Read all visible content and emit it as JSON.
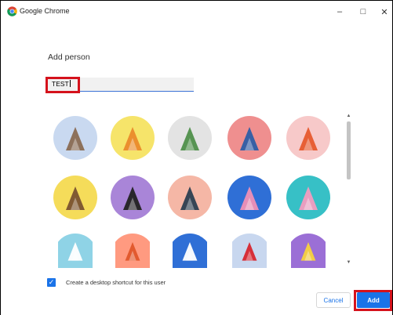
{
  "window": {
    "title": "Google Chrome",
    "controls": {
      "minimize": "–",
      "maximize": "□",
      "close": "✕"
    }
  },
  "dialog": {
    "heading": "Add person",
    "name_input": {
      "value": "TEST",
      "placeholder": ""
    },
    "avatars": [
      {
        "name": "origami cat",
        "bg": "#c9d9f0",
        "accent": "#8a6b52"
      },
      {
        "name": "origami fox",
        "bg": "#f6e46a",
        "accent": "#ea8a2b"
      },
      {
        "name": "origami dragon",
        "bg": "#e3e3e3",
        "accent": "#4f8f4a"
      },
      {
        "name": "origami elephant",
        "bg": "#ef8f8f",
        "accent": "#2d5ea6"
      },
      {
        "name": "origami fox red",
        "bg": "#f7c9c9",
        "accent": "#e65a2e"
      },
      {
        "name": "origami monkey",
        "bg": "#f5dc5a",
        "accent": "#7a5230"
      },
      {
        "name": "origami panda",
        "bg": "#a985d8",
        "accent": "#222222"
      },
      {
        "name": "origami penguin",
        "bg": "#f5b7a6",
        "accent": "#2c3e50"
      },
      {
        "name": "origami butterfly",
        "bg": "#2f6fd6",
        "accent": "#f08fb5"
      },
      {
        "name": "origami rabbit",
        "bg": "#37c0c6",
        "accent": "#f29cc0"
      },
      {
        "name": "origami unicorn",
        "bg": "#8fd3e6",
        "accent": "#ffffff"
      },
      {
        "name": "basketball",
        "bg": "#ff9a80",
        "accent": "#e0562a"
      },
      {
        "name": "bicycle",
        "bg": "#2f6fd6",
        "accent": "#ffffff"
      },
      {
        "name": "bird",
        "bg": "#c8d7ef",
        "accent": "#d7262e"
      },
      {
        "name": "cheese",
        "bg": "#9b6fd6",
        "accent": "#f7d23e"
      }
    ],
    "shortcut_checkbox": {
      "checked": true,
      "label": "Create a desktop shortcut for this user"
    },
    "buttons": {
      "cancel": "Cancel",
      "add": "Add"
    }
  },
  "colors": {
    "accent": "#1a73e8",
    "highlight": "#d5121c"
  }
}
